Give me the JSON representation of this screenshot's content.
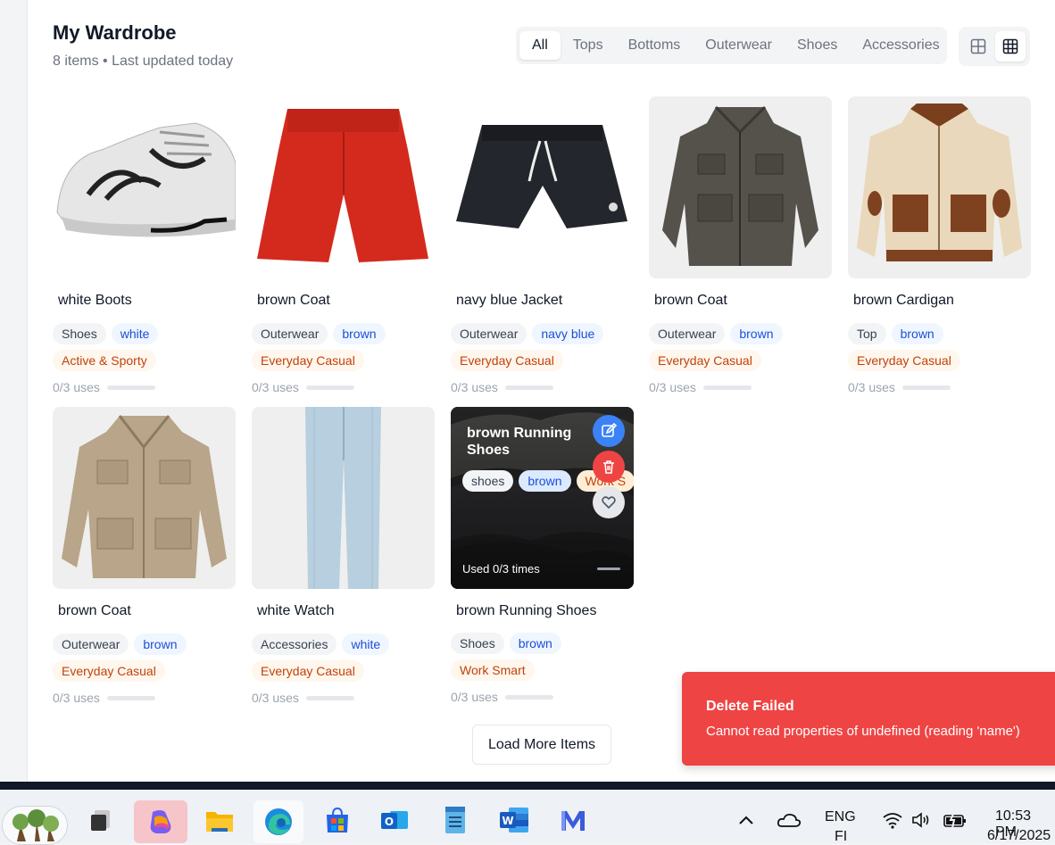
{
  "header": {
    "title": "My Wardrobe",
    "subtitle": "8 items • Last updated today"
  },
  "filters": [
    "All",
    "Tops",
    "Bottoms",
    "Outerwear",
    "Shoes",
    "Accessories"
  ],
  "active_filter": "All",
  "items": [
    {
      "name": "white Boots",
      "type": "Shoes",
      "color": "white",
      "style": "Active & Sporty",
      "uses": "0/3 uses"
    },
    {
      "name": "brown Coat",
      "type": "Outerwear",
      "color": "brown",
      "style": "Everyday Casual",
      "uses": "0/3 uses"
    },
    {
      "name": "navy blue Jacket",
      "type": "Outerwear",
      "color": "navy blue",
      "style": "Everyday Casual",
      "uses": "0/3 uses"
    },
    {
      "name": "brown Coat",
      "type": "Outerwear",
      "color": "brown",
      "style": "Everyday Casual",
      "uses": "0/3 uses"
    },
    {
      "name": "brown Cardigan",
      "type": "Top",
      "color": "brown",
      "style": "Everyday Casual",
      "uses": "0/3 uses"
    },
    {
      "name": "brown Coat",
      "type": "Outerwear",
      "color": "brown",
      "style": "Everyday Casual",
      "uses": "0/3 uses"
    },
    {
      "name": "white Watch",
      "type": "Accessories",
      "color": "white",
      "style": "Everyday Casual",
      "uses": "0/3 uses"
    },
    {
      "name": "brown Running Shoes",
      "type": "Shoes",
      "color": "brown",
      "style": "Work Smart",
      "uses": "0/3 uses"
    }
  ],
  "hover_card": {
    "title": "brown Running Shoes",
    "tags": [
      "shoes",
      "brown",
      "Work S"
    ],
    "usage": "Used 0/3 times"
  },
  "load_more": "Load More Items",
  "toast": {
    "title": "Delete Failed",
    "message": "Cannot read properties of undefined (reading 'name')"
  },
  "taskbar": {
    "language_line1": "ENG",
    "language_line2": "FI",
    "time": "10:53 PM",
    "date": "6/17/2025"
  },
  "colors": {
    "accent_blue": "#3b82f6",
    "danger_red": "#ef4444"
  }
}
